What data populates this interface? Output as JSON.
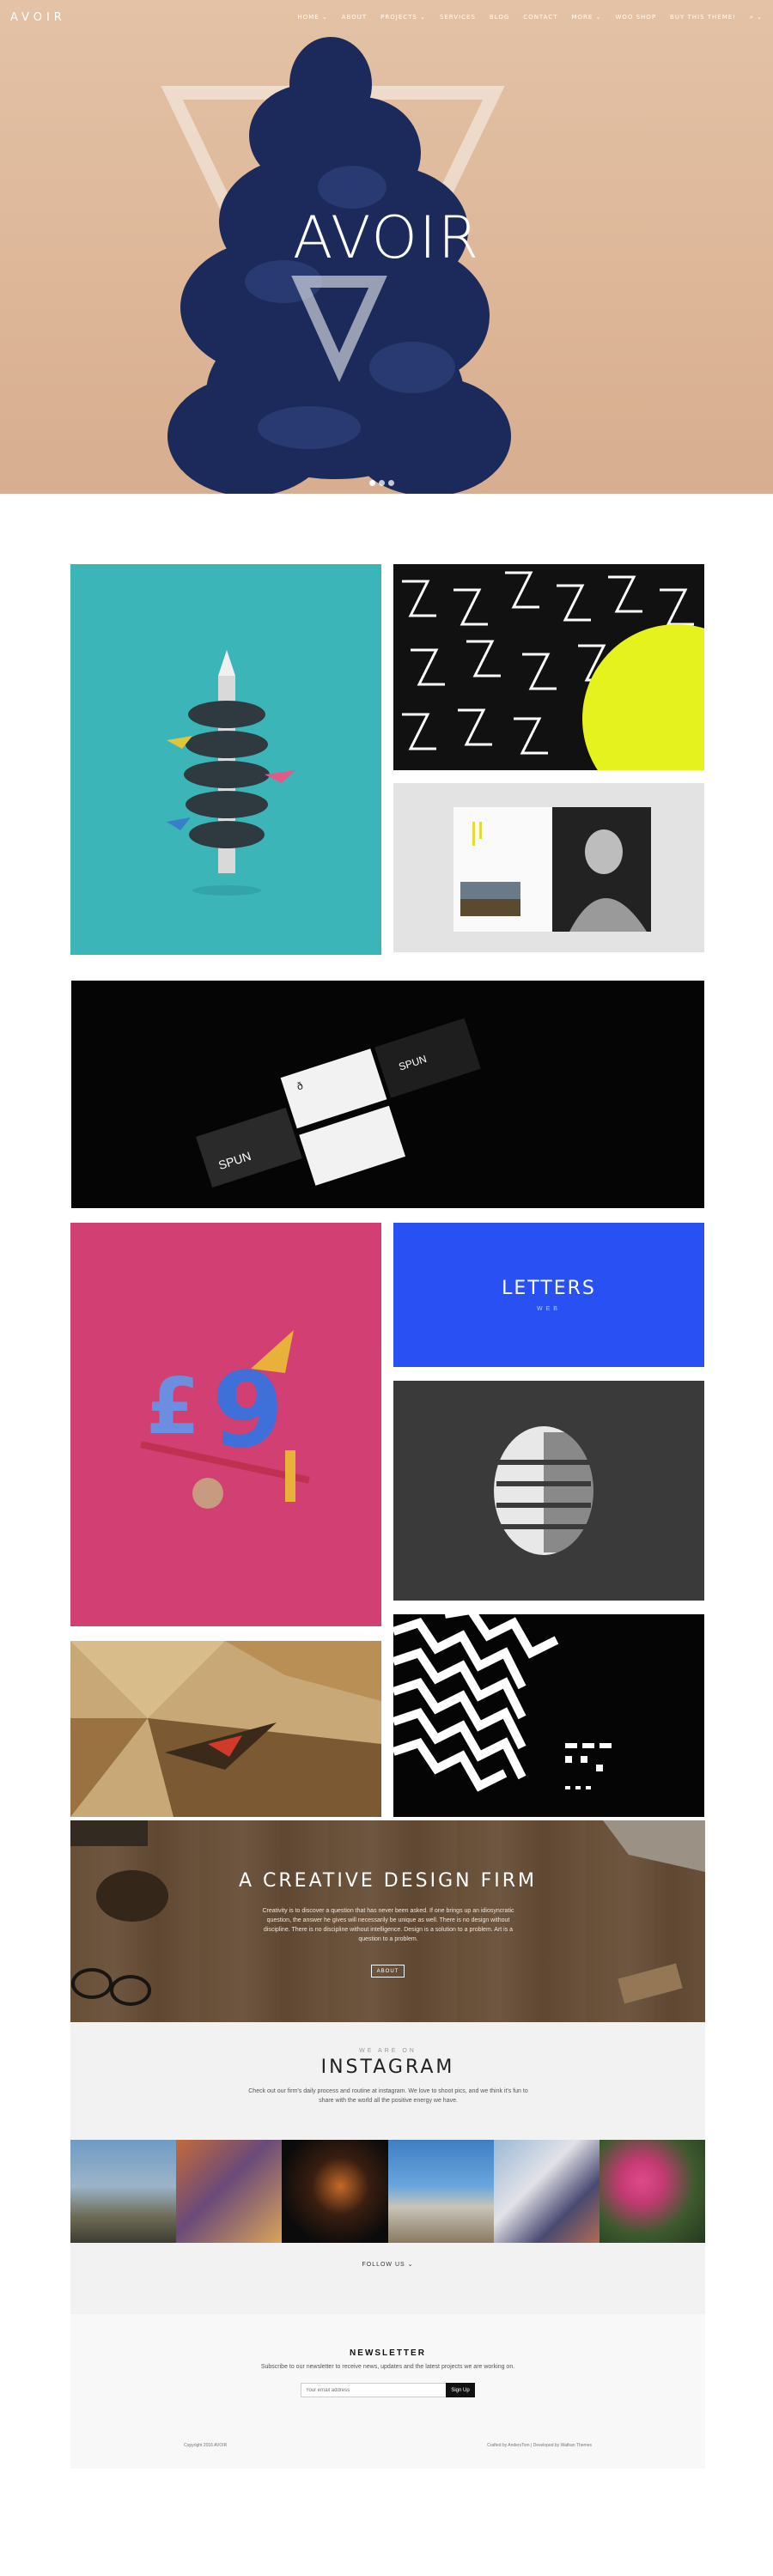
{
  "brand": {
    "logo": "AVOIR"
  },
  "nav": {
    "items": [
      "HOME ⌄",
      "ABOUT",
      "PROJECTS ⌄",
      "SERVICES",
      "BLOG",
      "CONTACT",
      "MORE ⌄",
      "WOO SHOP",
      "BUY THIS THEME!",
      "⌕ ⌄"
    ]
  },
  "hero": {
    "title": "AVOIR",
    "background": "#dcb696",
    "ink_color": "#1b2a5a",
    "slides": 3,
    "active_slide": 1
  },
  "portfolio": {
    "letters_tile": {
      "title": "LETTERS",
      "subtitle": "WEB"
    }
  },
  "creative": {
    "title": "A CREATIVE DESIGN FIRM",
    "text": "Creativity is to discover a question that has never been asked. If one brings up an idiosyncratic question, the answer he gives will necessarily be unique as well. There is no design without discipline. There is no discipline without intelligence. Design is a solution to a problem. Art is a question to a problem.",
    "button": "ABOUT"
  },
  "instagram": {
    "kicker": "WE ARE ON",
    "title": "INSTAGRAM",
    "text": "Check out our firm's daily process and routine at instagram. We love to shoot pics, and we think it's fun to share with the world all the positive energy we have.",
    "photo_caption": "",
    "follow": "FOLLOW US ⌄"
  },
  "newsletter": {
    "title": "NEWSLETTER",
    "text": "Subscribe to our newsletter to receive news, updates and the latest projects we are working on.",
    "placeholder": "Your email address",
    "button": "Sign Up"
  },
  "footer": {
    "copyright": "Copyright 2016 AVOIR",
    "credits": "Crafted by AndersTom | Developed by Wathan Themes"
  }
}
